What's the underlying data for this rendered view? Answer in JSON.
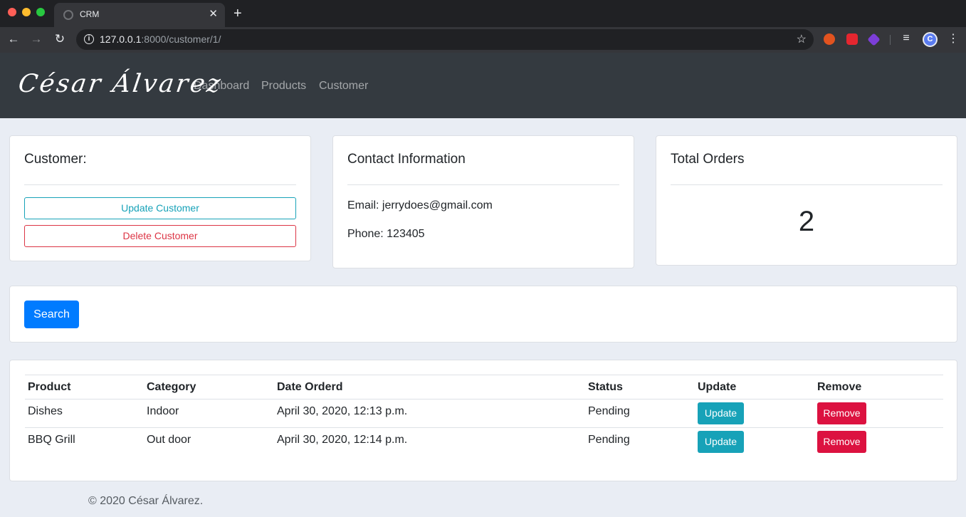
{
  "browser": {
    "tab_title": "CRM",
    "tab_close": "✕",
    "new_tab": "+",
    "url_host": "127.0.0.1",
    "url_rest": ":8000/customer/1/"
  },
  "navbar": {
    "brand": "César Álvarez",
    "links": [
      "Dashboard",
      "Products",
      "Customer"
    ]
  },
  "customer_card": {
    "title": "Customer:",
    "update_label": "Update Customer",
    "delete_label": "Delete Customer"
  },
  "contact_card": {
    "title": "Contact Information",
    "email": "Email: jerrydoes@gmail.com",
    "phone": "Phone: 123405"
  },
  "orders_card": {
    "title": "Total Orders",
    "count": "2"
  },
  "search": {
    "button_label": "Search"
  },
  "orders_table": {
    "headers": [
      "Product",
      "Category",
      "Date Orderd",
      "Status",
      "Update",
      "Remove"
    ],
    "rows": [
      {
        "product": "Dishes",
        "category": "Indoor",
        "date": "April 30, 2020, 12:13 p.m.",
        "status": "Pending",
        "update": "Update",
        "remove": "Remove"
      },
      {
        "product": "BBQ Grill",
        "category": "Out door",
        "date": "April 30, 2020, 12:14 p.m.",
        "status": "Pending",
        "update": "Update",
        "remove": "Remove"
      }
    ]
  },
  "footer": {
    "text": "© 2020 César Álvarez."
  },
  "colors": {
    "navbar": "#343a40",
    "primary": "#007bff",
    "info": "#17a2b8",
    "danger": "#dc3545"
  }
}
